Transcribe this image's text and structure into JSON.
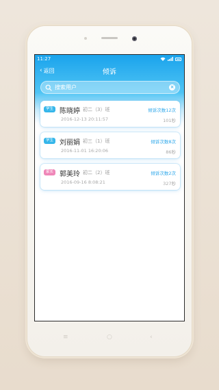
{
  "status_bar": {
    "time": "11:27"
  },
  "nav": {
    "back_label": "返回",
    "title": "倾诉"
  },
  "search": {
    "placeholder": "搜索用户"
  },
  "records": [
    {
      "badge": "学生",
      "badge_type": "student",
      "name": "陈晓婷",
      "class": "初二（3）班",
      "time": "2016-12-13  20:11:57",
      "count": "倾诉次数12次",
      "duration": "101秒"
    },
    {
      "badge": "学生",
      "badge_type": "student",
      "name": "刘丽娟",
      "class": "初三（1）班",
      "time": "2016-11-01  16:20:06",
      "count": "倾诉次数8次",
      "duration": "86秒"
    },
    {
      "badge": "家长",
      "badge_type": "parent",
      "name": "郭美玲",
      "class": "初二（2）班",
      "time": "2016-09-16  8:08:21",
      "count": "倾诉次数2次",
      "duration": "327秒"
    }
  ],
  "colors": {
    "accent": "#1aa3ec",
    "student_badge": "#35b6ea",
    "parent_badge": "#ef86b8"
  }
}
